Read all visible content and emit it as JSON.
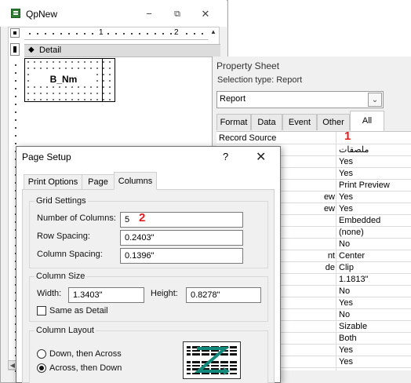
{
  "design_window": {
    "title": "QpNew",
    "window_buttons": [
      "−",
      "⧉",
      "✕"
    ],
    "ruler_numbers": [
      "1",
      "2"
    ],
    "section_label": "Detail",
    "grid_label": "B_Nm"
  },
  "property_sheet": {
    "title": "Property Sheet",
    "selection_type": "Selection type:  Report",
    "selected_object": "Report",
    "tabs": [
      "Format",
      "Data",
      "Event",
      "Other",
      "All"
    ],
    "active_tab": "All",
    "rows": [
      {
        "name": "Record Source",
        "value": ""
      },
      {
        "name": "",
        "value": "ملصقات"
      },
      {
        "name": "",
        "value": "Yes"
      },
      {
        "name": "",
        "value": "Yes"
      },
      {
        "name": "",
        "value": "Print Preview"
      },
      {
        "name": "ew",
        "value": "Yes"
      },
      {
        "name": "ew",
        "value": "Yes"
      },
      {
        "name": "",
        "value": "Embedded"
      },
      {
        "name": "",
        "value": "(none)"
      },
      {
        "name": "",
        "value": "No"
      },
      {
        "name": "nt",
        "value": "Center"
      },
      {
        "name": "de",
        "value": "Clip"
      },
      {
        "name": "",
        "value": "1.1813\""
      },
      {
        "name": "",
        "value": "No"
      },
      {
        "name": "",
        "value": "Yes"
      },
      {
        "name": "",
        "value": "No"
      },
      {
        "name": "",
        "value": "Sizable"
      },
      {
        "name": "",
        "value": "Both"
      },
      {
        "name": "",
        "value": "Yes"
      },
      {
        "name": "",
        "value": "Yes"
      }
    ]
  },
  "page_setup": {
    "title": "Page Setup",
    "help": "?",
    "close": "✕",
    "tabs": [
      "Print Options",
      "Page",
      "Columns"
    ],
    "active_tab": "Columns",
    "grid_settings": {
      "title": "Grid Settings",
      "number_of_columns_label": "Number of Columns:",
      "number_of_columns": "5",
      "row_spacing_label": "Row Spacing:",
      "row_spacing": "0.2403\"",
      "column_spacing_label": "Column Spacing:",
      "column_spacing": "0.1396\""
    },
    "column_size": {
      "title": "Column Size",
      "width_label": "Width:",
      "width": "1.3403\"",
      "height_label": "Height:",
      "height": "0.8278\"",
      "same_as_detail_label": "Same as Detail",
      "same_as_detail": false
    },
    "column_layout": {
      "title": "Column Layout",
      "option_down": "Down, then Across",
      "option_across": "Across, then Down",
      "selected": "Across, then Down"
    }
  },
  "annotations": [
    "1",
    "2"
  ],
  "colors": {
    "annotation": "#e31c1c",
    "layout_arrow": "#138a7c",
    "dialog_bg": "#f0f0f0"
  }
}
